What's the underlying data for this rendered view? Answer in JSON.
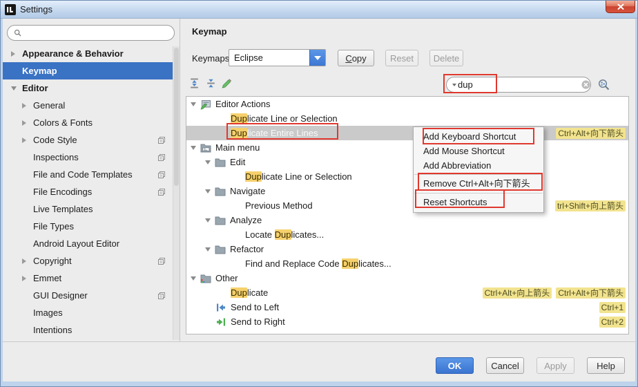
{
  "window": {
    "title": "Settings"
  },
  "sidebar": {
    "search_placeholder": "",
    "items": [
      {
        "label": "Appearance & Behavior",
        "arrow": "collapsed",
        "root": true
      },
      {
        "label": "Keymap",
        "selected": true,
        "root": true
      },
      {
        "label": "Editor",
        "arrow": "expanded",
        "root": true
      },
      {
        "label": "General",
        "arrow": "collapsed"
      },
      {
        "label": "Colors & Fonts",
        "arrow": "collapsed"
      },
      {
        "label": "Code Style",
        "arrow": "collapsed",
        "copy_icon": true
      },
      {
        "label": "Inspections",
        "copy_icon": true
      },
      {
        "label": "File and Code Templates",
        "copy_icon": true
      },
      {
        "label": "File Encodings",
        "copy_icon": true
      },
      {
        "label": "Live Templates"
      },
      {
        "label": "File Types"
      },
      {
        "label": "Android Layout Editor"
      },
      {
        "label": "Copyright",
        "arrow": "collapsed",
        "copy_icon": true
      },
      {
        "label": "Emmet",
        "arrow": "collapsed"
      },
      {
        "label": "GUI Designer",
        "copy_icon": true
      },
      {
        "label": "Images"
      },
      {
        "label": "Intentions"
      }
    ]
  },
  "header": {
    "title": "Keymap",
    "keymaps_label": "Keymaps:",
    "keymap_value": "Eclipse",
    "copy_label": "Copy",
    "reset_label": "Reset",
    "delete_label": "Delete"
  },
  "search": {
    "value": "dup"
  },
  "tree": {
    "rows": [
      {
        "pre": "Editor Actions",
        "level": 0,
        "arrow": true,
        "icon": "editor-actions-icon"
      },
      {
        "pre": "",
        "hl": "Dup",
        "post": "licate Line or Selection",
        "level": 2
      },
      {
        "pre": "",
        "hl": "Dup",
        "post": "licate Entire Lines",
        "level": 2,
        "selected": true,
        "shortcuts": [
          "Ctrl+Alt+向下箭头"
        ]
      },
      {
        "pre": "Main menu",
        "level": 0,
        "arrow": true,
        "icon": "main-menu-icon"
      },
      {
        "pre": "Edit",
        "level": 1,
        "arrow": true,
        "icon": "folder-icon"
      },
      {
        "pre": "",
        "hl": "Dup",
        "post": "licate Line or Selection",
        "level": 3
      },
      {
        "pre": "Navigate",
        "level": 1,
        "arrow": true,
        "icon": "folder-icon"
      },
      {
        "pre": "Previous Method",
        "level": 3,
        "shortcuts": [
          "trl+Shift+向上箭头"
        ]
      },
      {
        "pre": "Analyze",
        "level": 1,
        "arrow": true,
        "icon": "folder-icon"
      },
      {
        "pre": "Locate ",
        "hl": "Dup",
        "post": "licates...",
        "level": 3
      },
      {
        "pre": "Refactor",
        "level": 1,
        "arrow": true,
        "icon": "folder-icon"
      },
      {
        "pre": "Find and Replace Code ",
        "hl": "Dup",
        "post": "licates...",
        "level": 3
      },
      {
        "pre": "Other",
        "level": 0,
        "arrow": true,
        "icon": "other-folder-icon"
      },
      {
        "pre": "",
        "hl": "Dup",
        "post": "licate",
        "level": 2,
        "shortcuts": [
          "Ctrl+Alt+向上箭头",
          "Ctrl+Alt+向下箭头"
        ]
      },
      {
        "pre": "Send to Left",
        "level": 2,
        "iconrow": true,
        "icon": "send-left-icon",
        "shortcuts": [
          "Ctrl+1"
        ]
      },
      {
        "pre": "Send to Right",
        "level": 2,
        "iconrow": true,
        "icon": "send-right-icon",
        "shortcuts": [
          "Ctrl+2"
        ]
      }
    ]
  },
  "context_menu": {
    "items": [
      "Add Keyboard Shortcut",
      "Add Mouse Shortcut",
      "Add Abbreviation",
      "Remove Ctrl+Alt+向下箭头",
      "Reset Shortcuts"
    ]
  },
  "footer": {
    "ok_label": "OK",
    "cancel_label": "Cancel",
    "apply_label": "Apply",
    "help_label": "Help"
  },
  "colors": {
    "selection_blue": "#3a72c4",
    "highlight_yellow": "#f5d06c",
    "badge_yellow": "#f2e38f",
    "annotation_red": "#e0382e"
  }
}
